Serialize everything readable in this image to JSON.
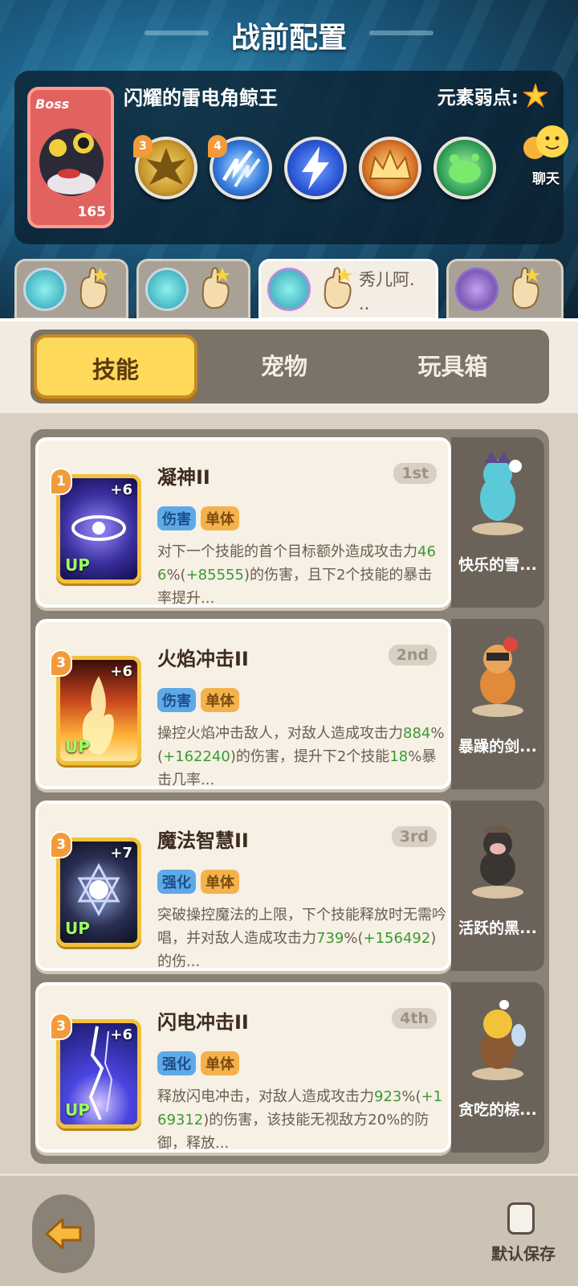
{
  "header": {
    "title": "战前配置"
  },
  "boss": {
    "tag": "Boss",
    "level": "165",
    "name": "闪耀的雷电角鲸王",
    "weakness_label": "元素弱点:",
    "skills": [
      {
        "badge": "3",
        "icon": "burst-icon",
        "color": "#c99a2e"
      },
      {
        "badge": "4",
        "icon": "lightning-slash-icon",
        "color": "#3a7fe0"
      },
      {
        "badge": "",
        "icon": "lightning-bolt-icon",
        "color": "#2b56d6"
      },
      {
        "badge": "",
        "icon": "crown-icon",
        "color": "#d8752a"
      },
      {
        "badge": "",
        "icon": "slime-icon",
        "color": "#34a35a"
      }
    ]
  },
  "chat": {
    "label": "聊天"
  },
  "team": [
    {
      "name": ""
    },
    {
      "name": ""
    },
    {
      "name": "秀儿阿.\n.."
    },
    {
      "name": ""
    }
  ],
  "tabs": [
    {
      "label": "技能"
    },
    {
      "label": "宠物"
    },
    {
      "label": "玩具箱"
    }
  ],
  "skills": [
    {
      "level": "1",
      "plus": "+6",
      "up": "UP",
      "name": "凝神II",
      "rank": "1st",
      "tags": [
        "伤害",
        "单体"
      ],
      "desc": [
        {
          "t": "对下一个技能的首个目标额外造成攻击力"
        },
        {
          "t": "466",
          "g": true
        },
        {
          "t": "%("
        },
        {
          "t": "+85555",
          "g": true
        },
        {
          "t": ")的伤害，且下2个技能的暴击率提升..."
        }
      ],
      "pet": "快乐的雪...",
      "icon_color": "#3a2f9e"
    },
    {
      "level": "3",
      "plus": "+6",
      "up": "UP",
      "name": "火焰冲击II",
      "rank": "2nd",
      "tags": [
        "伤害",
        "单体"
      ],
      "desc": [
        {
          "t": "操控火焰冲击敌人，对敌人造成攻击力"
        },
        {
          "t": "884",
          "g": true
        },
        {
          "t": "%("
        },
        {
          "t": "+162240",
          "g": true
        },
        {
          "t": ")的伤害，提升下2个技能"
        },
        {
          "t": "18",
          "g": true
        },
        {
          "t": "%暴击几率..."
        }
      ],
      "pet": "暴躁的剑...",
      "icon_color": "#c8451c"
    },
    {
      "level": "3",
      "plus": "+7",
      "up": "UP",
      "name": "魔法智慧II",
      "rank": "3rd",
      "tags": [
        "强化",
        "单体"
      ],
      "desc": [
        {
          "t": "突破操控魔法的上限，下个技能释放时无需吟唱，并对敌人造成攻击力"
        },
        {
          "t": "739",
          "g": true
        },
        {
          "t": "%("
        },
        {
          "t": "+156492",
          "g": true
        },
        {
          "t": ")的伤..."
        }
      ],
      "pet": "活跃的黑...",
      "icon_color": "#2a2e52"
    },
    {
      "level": "3",
      "plus": "+6",
      "up": "UP",
      "name": "闪电冲击II",
      "rank": "4th",
      "tags": [
        "强化",
        "单体"
      ],
      "desc": [
        {
          "t": "释放闪电冲击，对敌人造成攻击力"
        },
        {
          "t": "923",
          "g": true
        },
        {
          "t": "%("
        },
        {
          "t": "+169312",
          "g": true
        },
        {
          "t": ")的伤害，该技能无视敌方20%的防御，释放..."
        }
      ],
      "pet": "贪吃的棕...",
      "icon_color": "#2a2fa8"
    }
  ],
  "footer": {
    "save_label": "默认保存"
  }
}
